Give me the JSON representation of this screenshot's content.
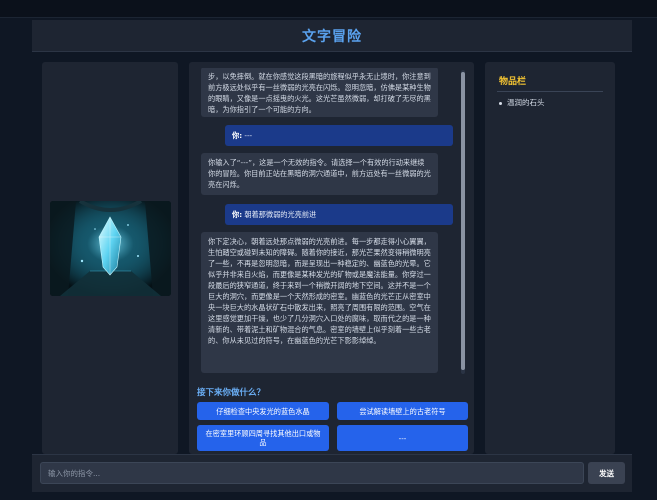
{
  "app": {
    "title": "文字冒险"
  },
  "scene": {
    "image_icon": "crystal-cave-scene"
  },
  "log": [
    {
      "type": "system",
      "text": "步，以免摔倒。就在你感觉这段黑暗的旅程似乎永无止境时，你注意到前方极远处似乎有一丝微弱的光亮在闪烁。忽明忽暗，仿佛是某种生物的眼睛，又像是一点摇曳的火光。这光芒虽然微弱，却打破了无尽的黑暗，为你指引了一个可能的方向。"
    },
    {
      "type": "user",
      "prefix": "你:",
      "text": " ---"
    },
    {
      "type": "system",
      "text": "你输入了“---”，这是一个无效的指令。请选择一个有效的行动来继续你的冒险。你目前正站在黑暗的洞穴通道中，前方远处有一丝微弱的光亮在闪烁。"
    },
    {
      "type": "user",
      "prefix": "你:",
      "text": " 朝着那微弱的光亮前进"
    },
    {
      "type": "system",
      "text": "你下定决心，朝着远处那点微弱的光亮前进。每一步都走得小心翼翼，生怕踏空或碰到未知的障碍。随着你的接近，那光芒果然变得稍微明亮了一些，不再是忽明忽暗，而是呈现出一种稳定的、幽蓝色的光晕。它似乎并非来自火焰，而更像是某种发光的矿物或是魔法能量。你穿过一段最后的狭窄通道，终于来到一个稍微开阔的地下空间。这并不是一个巨大的洞穴，而更像是一个天然形成的密室。幽蓝色的光芒正从密室中央一块巨大的水晶状矿石中散发出来，照亮了周围有限的范围。空气在这里感觉更加干燥，也少了几分洞穴入口处的腐味，取而代之的是一种清新的、带着泥土和矿物混合的气息。密室的墙壁上似乎刻着一些古老的、你从未见过的符号，在幽蓝色的光芒下影影绰绰。"
    }
  ],
  "choices": {
    "prompt": "接下来你做什么？",
    "options": [
      "仔细检查中央发光的蓝色水晶",
      "尝试解读墙壁上的古老符号",
      "在密室里环顾四周寻找其他出口或物品",
      "---"
    ]
  },
  "inventory": {
    "title": "物品栏",
    "items": [
      "温润的石头"
    ]
  },
  "command": {
    "placeholder": "输入你的指令...",
    "send_label": "发送"
  },
  "colors": {
    "accent": "#5aa2ee",
    "inventory_title": "#f1c232",
    "choice_button": "#2563eb",
    "user_bubble": "#1b3a8a"
  }
}
